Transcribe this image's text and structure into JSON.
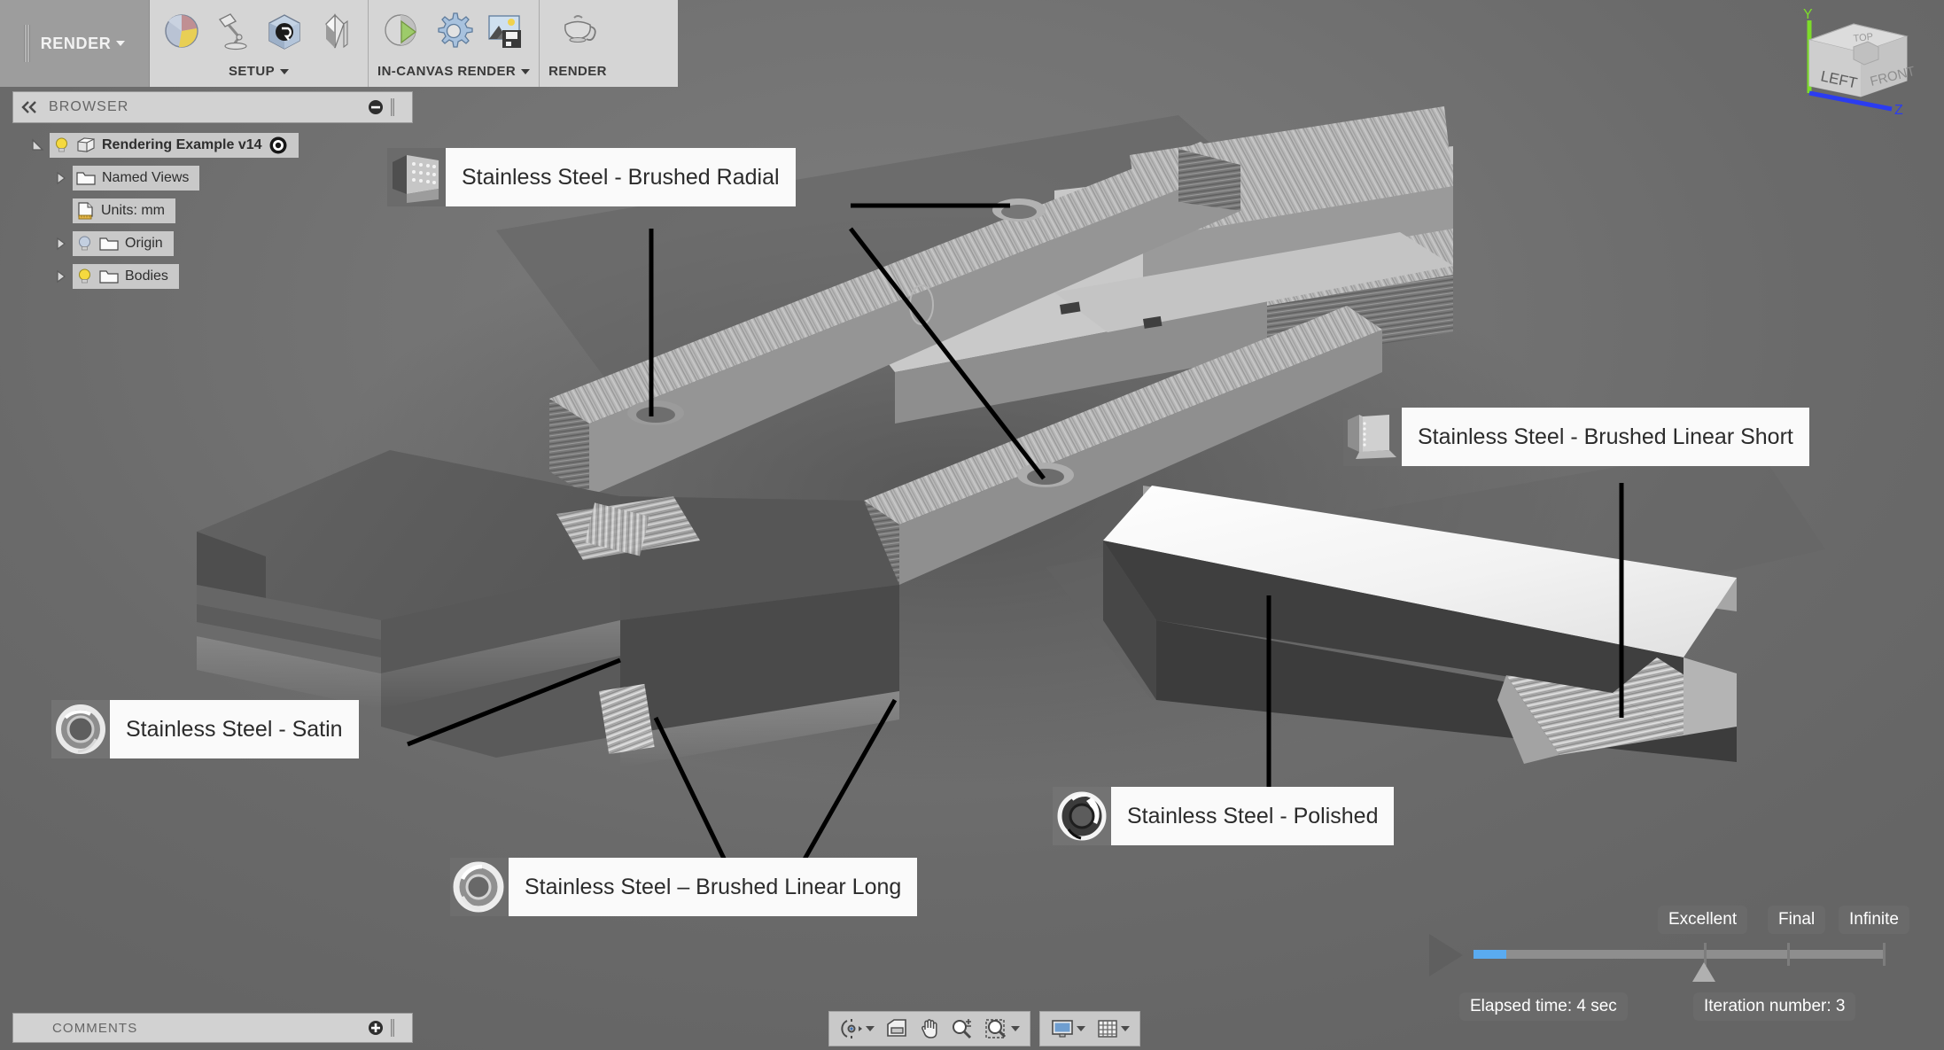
{
  "ribbon": {
    "tab_label": "RENDER",
    "panels": [
      {
        "name": "setup",
        "label": "SETUP",
        "has_caret": true,
        "buttons": [
          {
            "name": "appearance",
            "icon": "appearance-sphere-icon"
          },
          {
            "name": "scene-settings",
            "icon": "desk-lamp-icon"
          },
          {
            "name": "texture-map-controls",
            "icon": "texture-cube-icon"
          },
          {
            "name": "decal",
            "icon": "decal-icon"
          }
        ]
      },
      {
        "name": "in-canvas-render",
        "label": "IN-CANVAS RENDER",
        "has_caret": true,
        "buttons": [
          {
            "name": "in-canvas-render-play",
            "icon": "render-play-icon"
          },
          {
            "name": "in-canvas-render-settings",
            "icon": "gear-icon"
          },
          {
            "name": "capture-image",
            "icon": "save-image-icon"
          }
        ]
      },
      {
        "name": "render",
        "label": "RENDER",
        "has_caret": false,
        "buttons": [
          {
            "name": "render-teapot",
            "icon": "teapot-icon"
          }
        ]
      }
    ]
  },
  "browser": {
    "header_label": "BROWSER",
    "collapse_icon": "double-chevron-left-icon",
    "minimize_icon": "minus-circle-icon",
    "tree": [
      {
        "label": "Rendering Example v14",
        "icon": "component-cube-icon",
        "bulb": "lightbulb-on-icon",
        "twisty": "twisty-open-icon",
        "bold": true,
        "trailing_icon": "target-circle-icon",
        "indent": 0
      },
      {
        "label": "Named Views",
        "icon": "folder-icon",
        "bulb": null,
        "twisty": "twisty-closed-icon",
        "bold": false,
        "indent": 1
      },
      {
        "label": "Units: mm",
        "icon": "units-document-icon",
        "bulb": null,
        "twisty": null,
        "bold": false,
        "indent": 1
      },
      {
        "label": "Origin",
        "icon": "folder-icon",
        "bulb": "lightbulb-off-icon",
        "twisty": "twisty-closed-icon",
        "bold": false,
        "indent": 1
      },
      {
        "label": "Bodies",
        "icon": "folder-icon",
        "bulb": "lightbulb-on-icon",
        "twisty": "twisty-closed-icon",
        "bold": false,
        "indent": 1
      }
    ]
  },
  "callouts": [
    {
      "name": "brushed-radial",
      "label": "Stainless Steel - Brushed Radial",
      "swatch": "brushed-radial-swatch"
    },
    {
      "name": "brushed-linear-short",
      "label": "Stainless Steel - Brushed Linear Short",
      "swatch": "brushed-linear-short-swatch"
    },
    {
      "name": "satin",
      "label": "Stainless Steel - Satin",
      "swatch": "torus-satin-swatch"
    },
    {
      "name": "brushed-linear-long",
      "label": "Stainless Steel – Brushed Linear Long",
      "swatch": "torus-brushed-swatch"
    },
    {
      "name": "polished",
      "label": "Stainless Steel - Polished",
      "swatch": "torus-polished-swatch"
    }
  ],
  "render_control": {
    "quality_labels": [
      "Excellent",
      "Final",
      "Infinite"
    ],
    "elapsed": "Elapsed time: 4 sec",
    "iteration": "Iteration number: 3",
    "play_icon": "play-triangle-icon",
    "progress_percent": 8,
    "marker_percent": 56,
    "accent_color": "#5aabf0"
  },
  "comments": {
    "label": "COMMENTS",
    "add_icon": "plus-circle-icon"
  },
  "navbar": {
    "groups": [
      {
        "name": "view-tools",
        "buttons": [
          {
            "name": "orbit",
            "icon": "orbit-icon",
            "caret": true
          },
          {
            "name": "look-at",
            "icon": "look-at-icon",
            "caret": false
          },
          {
            "name": "pan",
            "icon": "pan-hand-icon",
            "caret": false
          },
          {
            "name": "zoom",
            "icon": "zoom-magnifier-icon",
            "caret": false
          },
          {
            "name": "zoom-window",
            "icon": "zoom-window-icon",
            "caret": true
          }
        ]
      },
      {
        "name": "display-tools",
        "buttons": [
          {
            "name": "display-settings",
            "icon": "monitor-icon",
            "caret": true
          },
          {
            "name": "grid-snaps",
            "icon": "grid-icon",
            "caret": true
          }
        ]
      }
    ]
  },
  "viewcube": {
    "faces": [
      "LEFT",
      "FRONT"
    ],
    "axes": [
      {
        "name": "y-axis",
        "label": "Y",
        "color": "#7ddc2a"
      },
      {
        "name": "z-axis",
        "label": "Z",
        "color": "#2b3cf0"
      }
    ]
  }
}
